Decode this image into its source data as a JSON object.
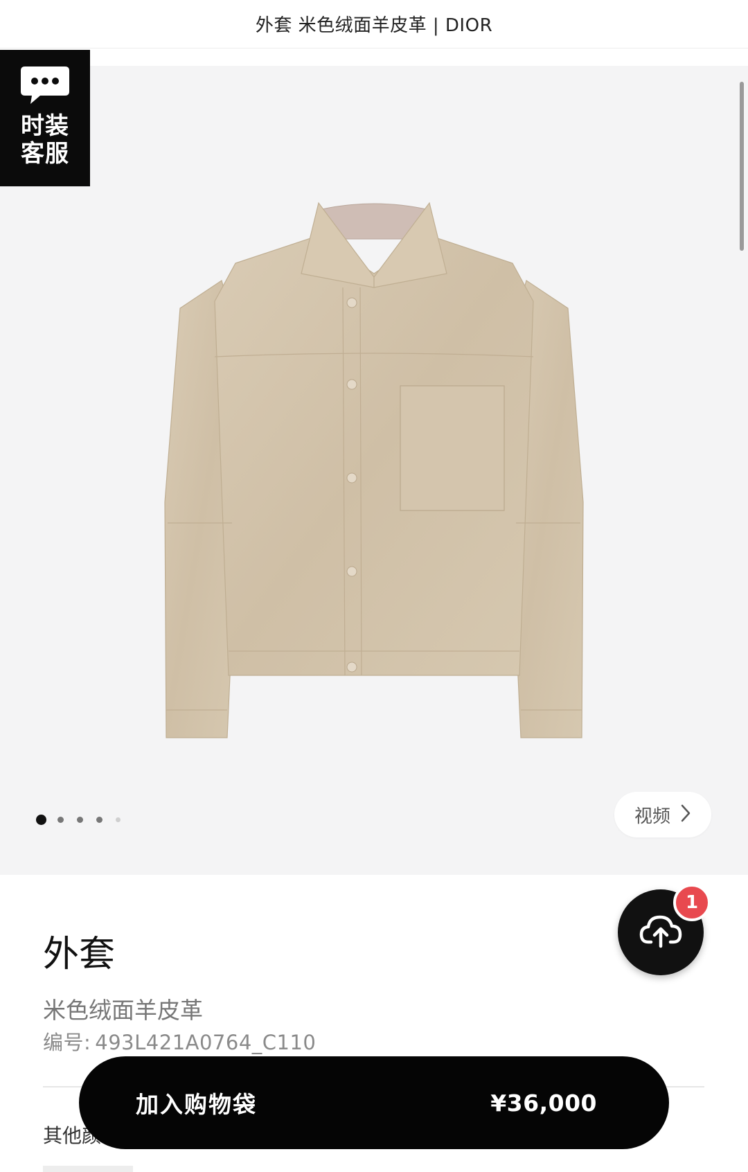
{
  "header": {
    "title": "外套 米色绒面羊皮革 | DIOR"
  },
  "service": {
    "icon": "chat-bubble-icon",
    "label_line1": "时装",
    "label_line2": "客服"
  },
  "gallery": {
    "image": "beige-suede-jacket",
    "dots_count": 5,
    "active_dot": 1,
    "video_label": "视频",
    "video_icon": "chevron-right-icon"
  },
  "fab": {
    "icon": "cloud-upload-icon",
    "badge": "1"
  },
  "product": {
    "title": "外套",
    "subtitle": "米色绒面羊皮革",
    "code_label": "编号:",
    "code_value": "493L421A0764_C110",
    "other_label": "其他颜"
  },
  "cta": {
    "label": "加入购物袋",
    "price": "¥36,000"
  },
  "colors": {
    "jacket": "#d2c3ab",
    "gallery_bg": "#f4f4f5",
    "cta_bg": "#050505",
    "badge": "#e8494f"
  }
}
